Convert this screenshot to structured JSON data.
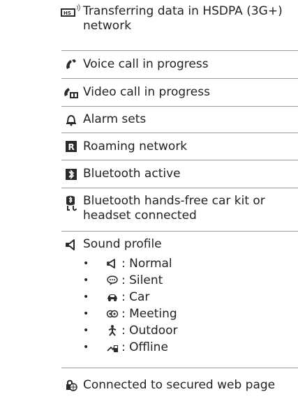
{
  "rows": [
    {
      "icon": "hsdpa-icon",
      "text": "Transferring data in HSDPA (3G+) network"
    },
    {
      "icon": "voice-call-icon",
      "text": "Voice call in progress"
    },
    {
      "icon": "video-call-icon",
      "text": "Video call in progress"
    },
    {
      "icon": "alarm-bell-icon",
      "text": "Alarm sets"
    },
    {
      "icon": "roaming-icon",
      "text": "Roaming network"
    },
    {
      "icon": "bluetooth-icon",
      "text": "Bluetooth active"
    },
    {
      "icon": "bluetooth-headset-icon",
      "text": "Bluetooth hands-free car kit or headset connected"
    },
    {
      "icon": "sound-profile-icon",
      "text": "Sound profile",
      "sub_items": [
        {
          "icon": "normal-speaker-icon",
          "text": ": Normal"
        },
        {
          "icon": "silent-speech-icon",
          "text": ": Silent"
        },
        {
          "icon": "car-icon",
          "text": ": Car"
        },
        {
          "icon": "meeting-icon",
          "text": ": Meeting"
        },
        {
          "icon": "outdoor-person-icon",
          "text": ": Outdoor"
        },
        {
          "icon": "offline-icon",
          "text": ": Offline"
        }
      ]
    },
    {
      "icon": "secured-web-icon",
      "text": "Connected to secured web page"
    }
  ],
  "bullet": "•"
}
